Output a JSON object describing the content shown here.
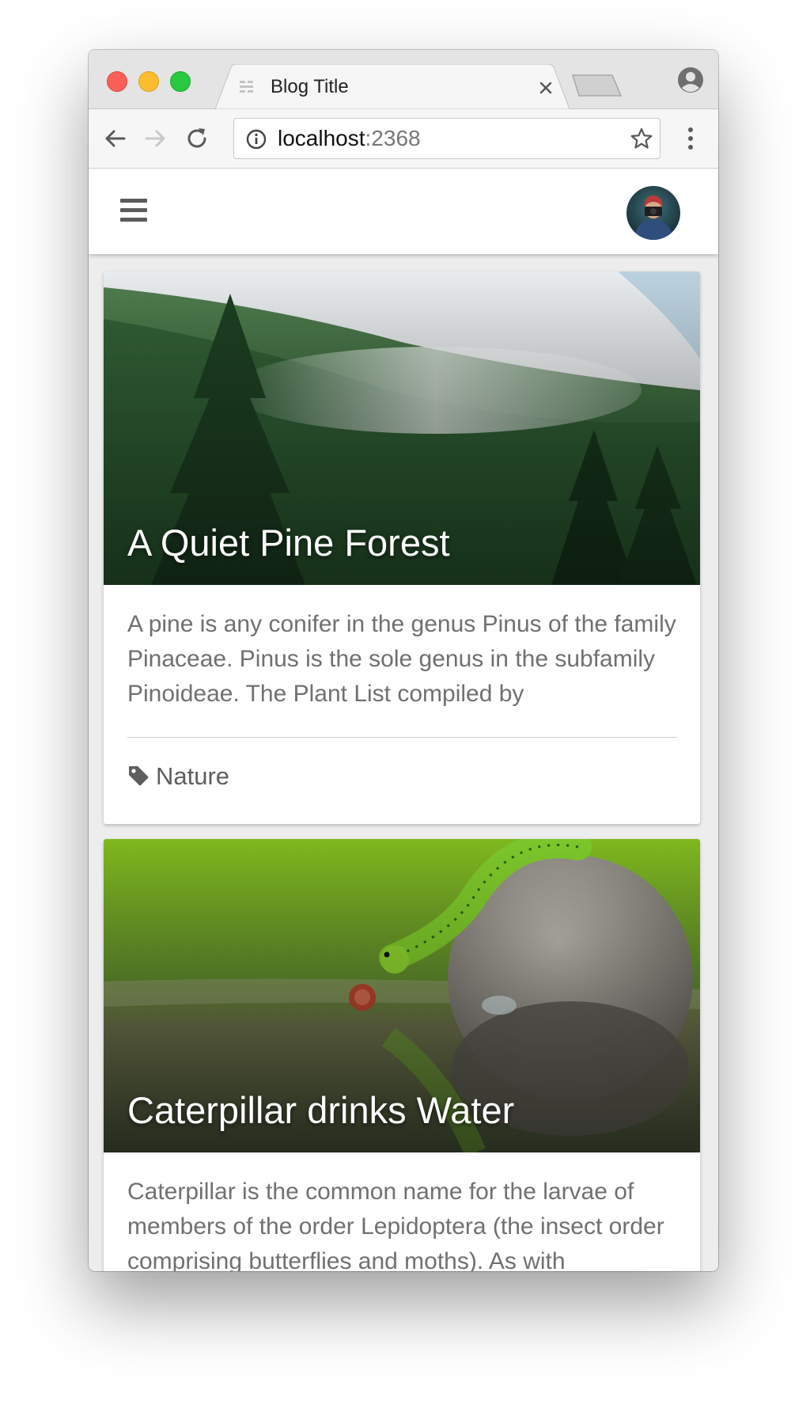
{
  "browser": {
    "tab_title": "Blog Title",
    "url_host": "localhost",
    "url_port": ":2368"
  },
  "posts": [
    {
      "title": "A Quiet Pine Forest",
      "excerpt": "A pine is any conifer in the genus Pinus of the family Pinaceae. Pinus is the sole genus in the subfamily Pinoideae. The Plant List compiled by",
      "tag": "Nature"
    },
    {
      "title": "Caterpillar drinks Water",
      "excerpt": "Caterpillar is the common name for the larvae of members of the order Lepidoptera (the insect order comprising butterflies and moths). As with"
    }
  ],
  "colors": {
    "traffic_red": "#fc5f57",
    "traffic_yellow": "#fdbc2e",
    "traffic_green": "#29c940",
    "page_bg": "#ededed",
    "excerpt_text": "#707070"
  },
  "icons": [
    "close-icon",
    "back-icon",
    "forward-icon",
    "reload-icon",
    "info-icon",
    "star-icon",
    "menu-icon",
    "hamburger-icon",
    "tag-icon",
    "profile-icon"
  ]
}
